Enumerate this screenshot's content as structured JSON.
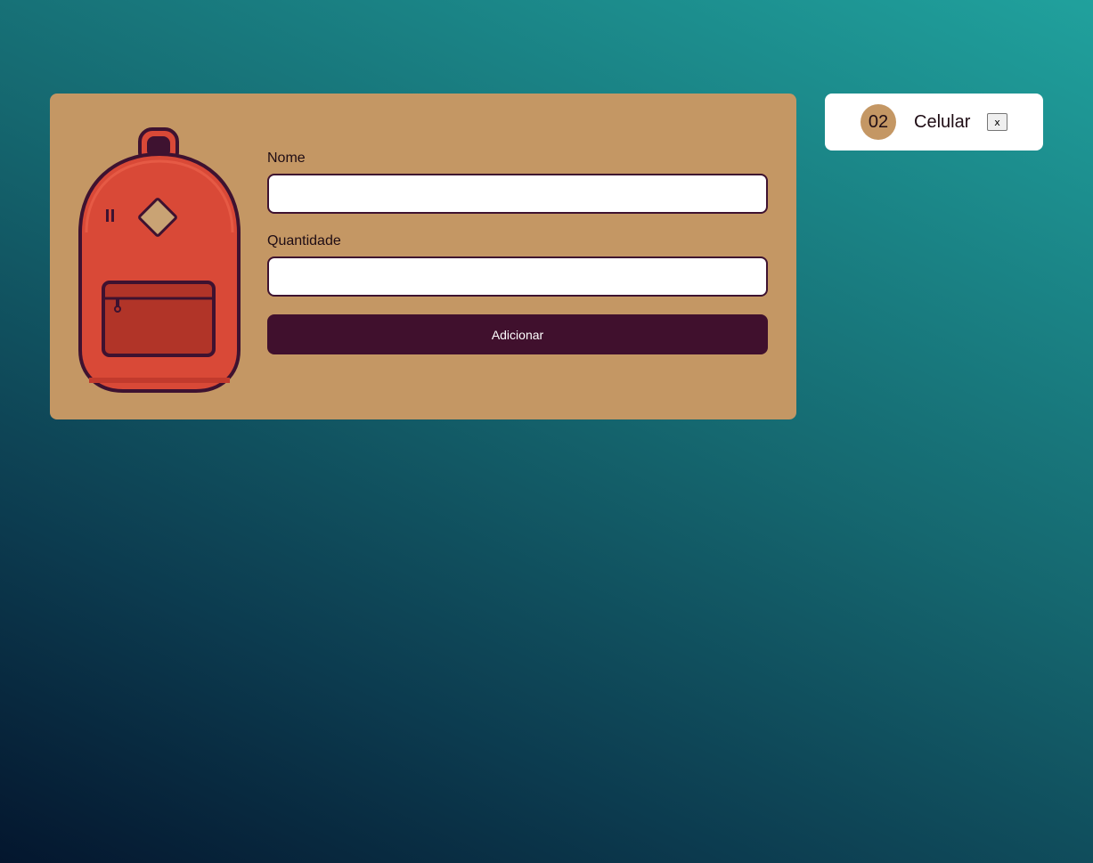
{
  "form": {
    "name_label": "Nome",
    "name_value": "",
    "quantity_label": "Quantidade",
    "quantity_value": "",
    "submit_label": "Adicionar"
  },
  "illustration": {
    "icon": "backpack-icon"
  },
  "items": [
    {
      "quantity": "02",
      "name": "Celular",
      "remove_label": "x"
    }
  ],
  "colors": {
    "card_background": "#c49764",
    "button_background": "#40102d",
    "backpack_red": "#d94937",
    "backpack_outline": "#3e1230",
    "background_gradient_top": "#20a19d",
    "background_gradient_bottom": "#04162e"
  }
}
